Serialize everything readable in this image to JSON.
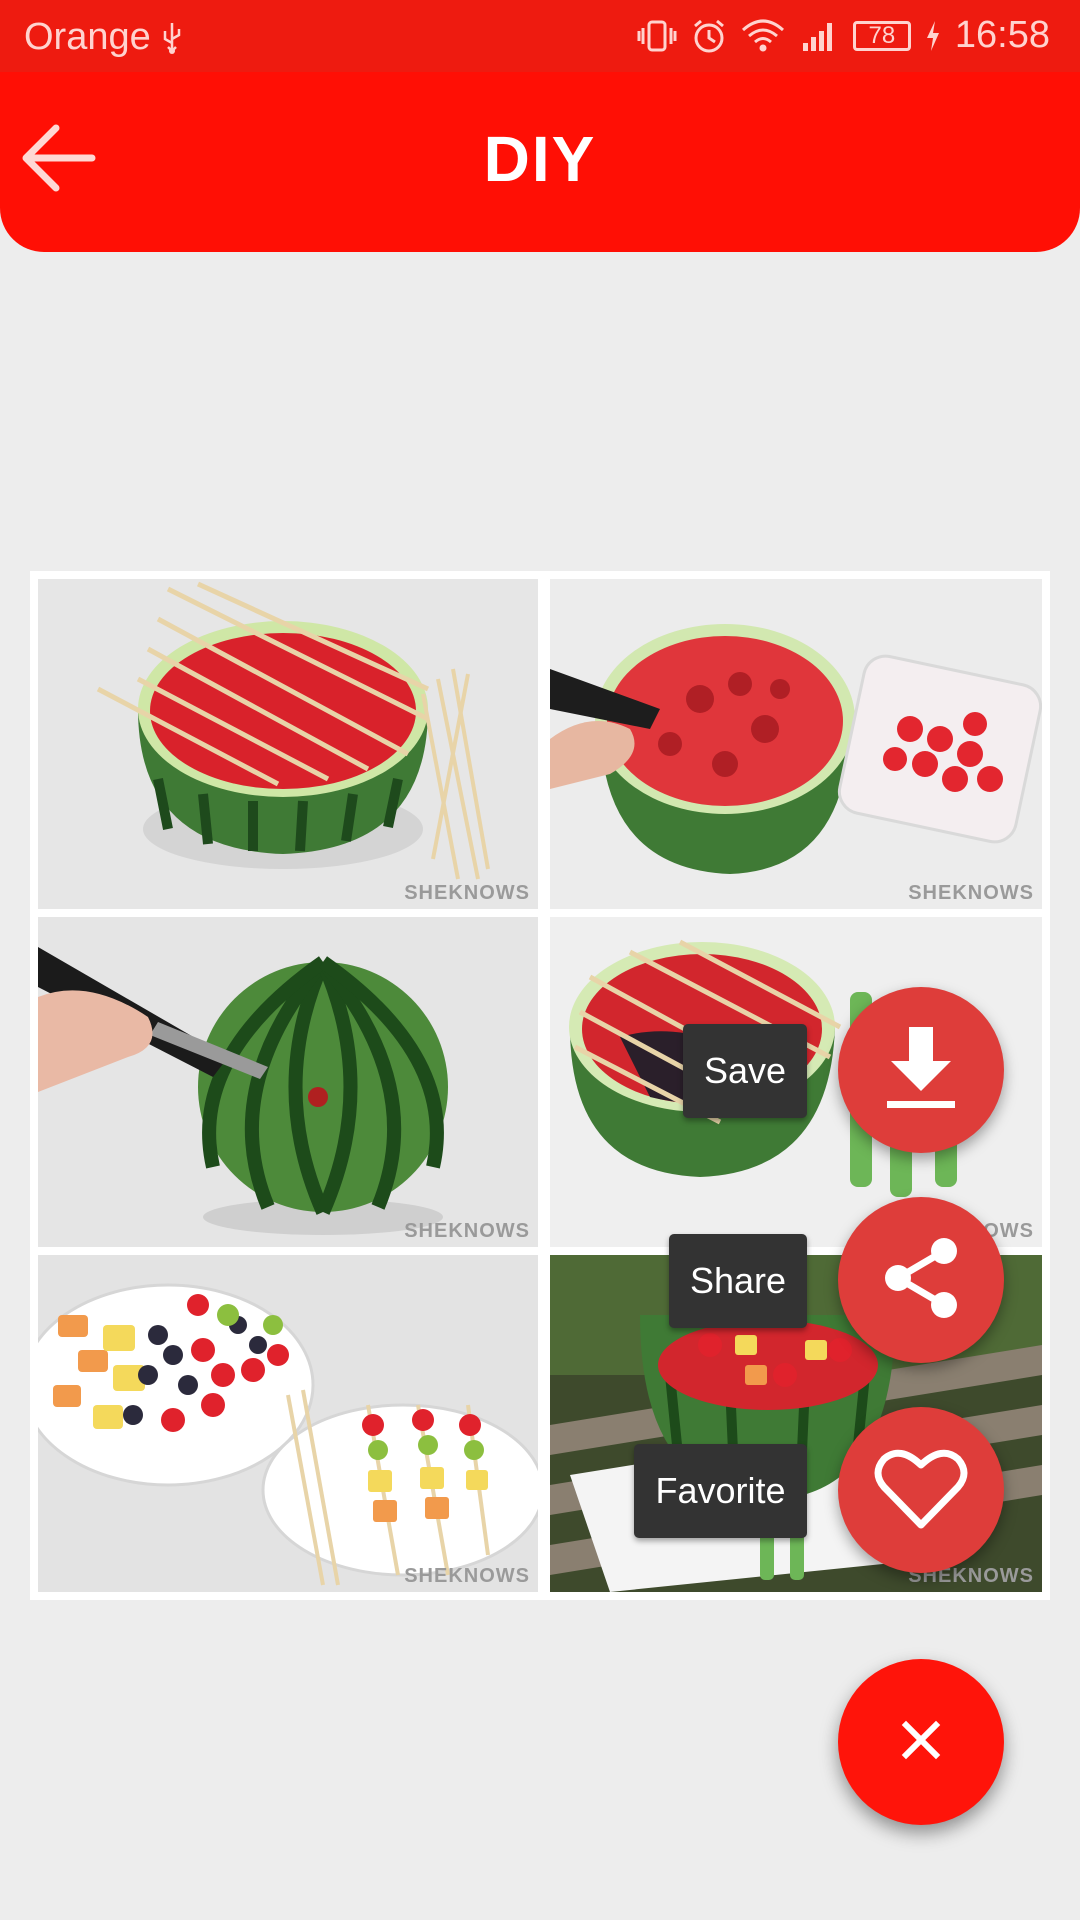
{
  "status_bar": {
    "carrier": "Orange",
    "battery_level": "78",
    "time": "16:58",
    "icons": [
      "usb-icon",
      "vibrate-icon",
      "alarm-icon",
      "wifi-icon",
      "signal-icon",
      "battery-icon",
      "charging-icon"
    ]
  },
  "app_bar": {
    "title": "DIY",
    "back_icon": "arrow-back-icon",
    "color": "#ff0f05"
  },
  "content": {
    "image_description_tiles": [
      {
        "watermark": "SHEKNOWS"
      },
      {
        "watermark": "SHEKNOWS"
      },
      {
        "watermark": "SHEKNOWS"
      },
      {
        "watermark": "SHEKNOWS"
      },
      {
        "watermark": "SHEKNOWS"
      },
      {
        "watermark": "SHEKNOWS"
      }
    ]
  },
  "fab_menu": {
    "actions": [
      {
        "label": "Save",
        "icon": "download-icon"
      },
      {
        "label": "Share",
        "icon": "share-icon"
      },
      {
        "label": "Favorite",
        "icon": "heart-outline-icon"
      }
    ],
    "close_icon": "close-icon",
    "main_color": "#ff140a",
    "mini_color": "#de3d3a"
  }
}
